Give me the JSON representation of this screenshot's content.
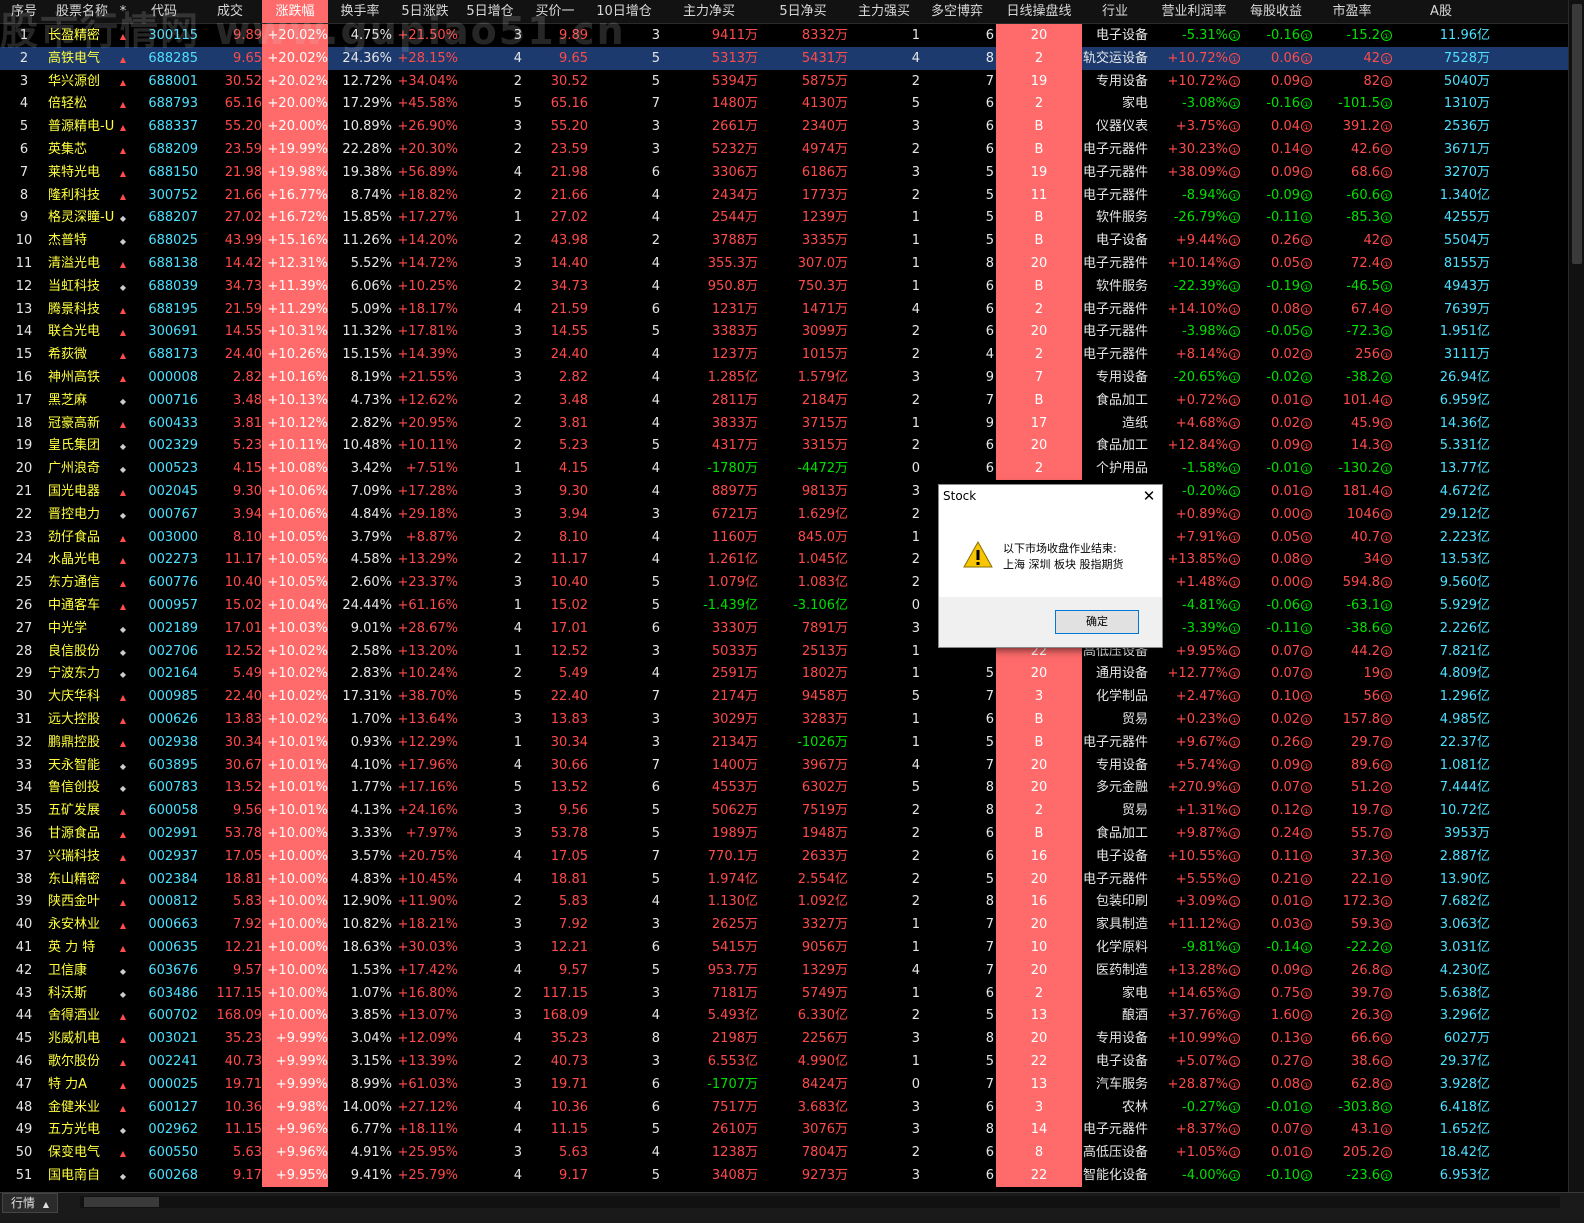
{
  "watermark": "股市行情网 www.gupiao51.cn",
  "header": [
    "序号",
    "股票名称",
    "*",
    "代码",
    "成交",
    "涨跌幅",
    "换手率",
    "5日涨跌",
    "5日增仓",
    "买价一",
    "10日增仓",
    "主力净买",
    "5日净买",
    "主力强买",
    "多空博弈",
    "日线操盘线",
    "行业",
    "营业利润率",
    "每股收益",
    "市盈率",
    "A股"
  ],
  "rows": [
    [
      "1",
      "长盈精密",
      "▲",
      "300115",
      "9.89",
      "+20.02%",
      "4.75%",
      "+21.50%",
      "3",
      "9.89",
      "3",
      "9411万",
      "8332万",
      "1",
      "6",
      "20",
      "电子设备",
      "-5.31%",
      "-0.16",
      "-15.2",
      "11.96亿"
    ],
    [
      "2",
      "高铁电气",
      "▲",
      "688285",
      "9.65",
      "+20.02%",
      "24.36%",
      "+28.15%",
      "4",
      "9.65",
      "5",
      "5313万",
      "5431万",
      "4",
      "8",
      "2",
      "轨交运设备",
      "+10.72%",
      "0.06",
      "42",
      "7528万"
    ],
    [
      "3",
      "华兴源创",
      "▲",
      "688001",
      "30.52",
      "+20.02%",
      "12.72%",
      "+34.04%",
      "2",
      "30.52",
      "5",
      "5394万",
      "5875万",
      "2",
      "7",
      "19",
      "专用设备",
      "+10.72%",
      "0.09",
      "82",
      "5040万"
    ],
    [
      "4",
      "倍轻松",
      "▲",
      "688793",
      "65.16",
      "+20.00%",
      "17.29%",
      "+45.58%",
      "5",
      "65.16",
      "7",
      "1480万",
      "4130万",
      "5",
      "6",
      "2",
      "家电",
      "-3.08%",
      "-0.16",
      "-101.5",
      "1310万"
    ],
    [
      "5",
      "普源精电-U",
      "▲",
      "688337",
      "55.20",
      "+20.00%",
      "10.89%",
      "+26.90%",
      "3",
      "55.20",
      "3",
      "2661万",
      "2340万",
      "3",
      "6",
      "B",
      "仪器仪表",
      "+3.75%",
      "0.04",
      "391.2",
      "2536万"
    ],
    [
      "6",
      "英集芯",
      "▲",
      "688209",
      "23.59",
      "+19.99%",
      "22.28%",
      "+20.30%",
      "2",
      "23.59",
      "3",
      "5232万",
      "4974万",
      "2",
      "6",
      "B",
      "电子元器件",
      "+30.23%",
      "0.14",
      "42.6",
      "3671万"
    ],
    [
      "7",
      "莱特光电",
      "▲",
      "688150",
      "21.98",
      "+19.98%",
      "19.38%",
      "+56.89%",
      "4",
      "21.98",
      "6",
      "3306万",
      "6186万",
      "3",
      "5",
      "19",
      "电子元器件",
      "+38.09%",
      "0.09",
      "68.6",
      "3270万"
    ],
    [
      "8",
      "隆利科技",
      "▲",
      "300752",
      "21.66",
      "+16.77%",
      "8.74%",
      "+18.82%",
      "2",
      "21.66",
      "4",
      "2434万",
      "1773万",
      "2",
      "5",
      "11",
      "电子元器件",
      "-8.94%",
      "-0.09",
      "-60.6",
      "1.340亿"
    ],
    [
      "9",
      "格灵深瞳-U",
      "◆",
      "688207",
      "27.02",
      "+16.72%",
      "15.85%",
      "+17.27%",
      "1",
      "27.02",
      "4",
      "2544万",
      "1239万",
      "1",
      "5",
      "B",
      "软件服务",
      "-26.79%",
      "-0.11",
      "-85.3",
      "4255万"
    ],
    [
      "10",
      "杰普特",
      "◆",
      "688025",
      "43.99",
      "+15.16%",
      "11.26%",
      "+14.20%",
      "2",
      "43.98",
      "2",
      "3788万",
      "3335万",
      "1",
      "5",
      "B",
      "电子设备",
      "+9.44%",
      "0.26",
      "42",
      "5504万"
    ],
    [
      "11",
      "清溢光电",
      "▲",
      "688138",
      "14.42",
      "+12.31%",
      "5.52%",
      "+14.72%",
      "3",
      "14.40",
      "4",
      "355.3万",
      "307.0万",
      "1",
      "8",
      "20",
      "电子元器件",
      "+10.14%",
      "0.05",
      "72.4",
      "8155万"
    ],
    [
      "12",
      "当虹科技",
      "◆",
      "688039",
      "34.73",
      "+11.39%",
      "6.06%",
      "+10.25%",
      "2",
      "34.73",
      "4",
      "950.8万",
      "750.3万",
      "1",
      "6",
      "B",
      "软件服务",
      "-22.39%",
      "-0.19",
      "-46.5",
      "4943万"
    ],
    [
      "13",
      "腾景科技",
      "▲",
      "688195",
      "21.59",
      "+11.29%",
      "5.09%",
      "+18.17%",
      "4",
      "21.59",
      "6",
      "1231万",
      "1471万",
      "4",
      "6",
      "2",
      "电子元器件",
      "+14.10%",
      "0.08",
      "67.4",
      "7639万"
    ],
    [
      "14",
      "联合光电",
      "▲",
      "300691",
      "14.55",
      "+10.31%",
      "11.32%",
      "+17.81%",
      "3",
      "14.55",
      "5",
      "3383万",
      "3099万",
      "2",
      "6",
      "20",
      "电子元器件",
      "-3.98%",
      "-0.05",
      "-72.3",
      "1.951亿"
    ],
    [
      "15",
      "希荻微",
      "▲",
      "688173",
      "24.40",
      "+10.26%",
      "15.15%",
      "+14.39%",
      "3",
      "24.40",
      "4",
      "1237万",
      "1015万",
      "2",
      "4",
      "2",
      "电子元器件",
      "+8.14%",
      "0.02",
      "256",
      "3111万"
    ],
    [
      "16",
      "神州高铁",
      "▲",
      "000008",
      "2.82",
      "+10.16%",
      "8.19%",
      "+21.55%",
      "3",
      "2.82",
      "4",
      "1.285亿",
      "1.579亿",
      "3",
      "9",
      "7",
      "专用设备",
      "-20.65%",
      "-0.02",
      "-38.2",
      "26.94亿"
    ],
    [
      "17",
      "黑芝麻",
      "◆",
      "000716",
      "3.48",
      "+10.13%",
      "4.73%",
      "+12.62%",
      "2",
      "3.48",
      "4",
      "2811万",
      "2184万",
      "2",
      "7",
      "B",
      "食品加工",
      "+0.72%",
      "0.01",
      "101.4",
      "6.959亿"
    ],
    [
      "18",
      "冠豪高新",
      "▲",
      "600433",
      "3.81",
      "+10.12%",
      "2.82%",
      "+20.95%",
      "2",
      "3.81",
      "4",
      "3833万",
      "3715万",
      "1",
      "9",
      "17",
      "造纸",
      "+4.68%",
      "0.02",
      "45.9",
      "14.36亿"
    ],
    [
      "19",
      "皇氏集团",
      "◆",
      "002329",
      "5.23",
      "+10.11%",
      "10.48%",
      "+10.11%",
      "2",
      "5.23",
      "5",
      "4317万",
      "3315万",
      "2",
      "6",
      "20",
      "食品加工",
      "+12.84%",
      "0.09",
      "14.3",
      "5.331亿"
    ],
    [
      "20",
      "广州浪奇",
      "◆",
      "000523",
      "4.15",
      "+10.08%",
      "3.42%",
      "+7.51%",
      "1",
      "4.15",
      "4",
      "-1780万",
      "-4472万",
      "0",
      "6",
      "2",
      "个护用品",
      "-1.58%",
      "-0.01",
      "-130.2",
      "13.77亿"
    ],
    [
      "21",
      "国光电器",
      "▲",
      "002045",
      "9.30",
      "+10.06%",
      "7.09%",
      "+17.28%",
      "3",
      "9.30",
      "4",
      "8897万",
      "9813万",
      "3",
      "",
      "",
      "",
      "-0.20%",
      "0.01",
      "181.4",
      "4.672亿"
    ],
    [
      "22",
      "晋控电力",
      "◆",
      "000767",
      "3.94",
      "+10.06%",
      "4.84%",
      "+29.18%",
      "3",
      "3.94",
      "3",
      "6721万",
      "1.629亿",
      "2",
      "",
      "",
      "",
      "+0.89%",
      "0.00",
      "1046",
      "29.12亿"
    ],
    [
      "23",
      "劲仔食品",
      "▲",
      "003000",
      "8.10",
      "+10.05%",
      "3.79%",
      "+8.87%",
      "2",
      "8.10",
      "4",
      "1160万",
      "845.0万",
      "1",
      "",
      "",
      "",
      "+7.91%",
      "0.05",
      "40.7",
      "2.223亿"
    ],
    [
      "24",
      "水晶光电",
      "▲",
      "002273",
      "11.17",
      "+10.05%",
      "4.58%",
      "+13.29%",
      "2",
      "11.17",
      "4",
      "1.261亿",
      "1.045亿",
      "2",
      "",
      "",
      "",
      "+13.85%",
      "0.08",
      "34",
      "13.53亿"
    ],
    [
      "25",
      "东方通信",
      "▲",
      "600776",
      "10.40",
      "+10.05%",
      "2.60%",
      "+23.37%",
      "3",
      "10.40",
      "5",
      "1.079亿",
      "1.083亿",
      "2",
      "",
      "",
      "",
      "+1.48%",
      "0.00",
      "594.8",
      "9.560亿"
    ],
    [
      "26",
      "中通客车",
      "▲",
      "000957",
      "15.02",
      "+10.04%",
      "24.44%",
      "+61.16%",
      "1",
      "15.02",
      "5",
      "-1.439亿",
      "-3.106亿",
      "0",
      "",
      "",
      "",
      "-4.81%",
      "-0.06",
      "-63.1",
      "5.929亿"
    ],
    [
      "27",
      "中光学",
      "◆",
      "002189",
      "17.01",
      "+10.03%",
      "9.01%",
      "+28.67%",
      "4",
      "17.01",
      "6",
      "3330万",
      "7891万",
      "3",
      "",
      "",
      "",
      "-3.39%",
      "-0.11",
      "-38.6",
      "2.226亿"
    ],
    [
      "28",
      "良信股份",
      "◆",
      "002706",
      "12.52",
      "+10.02%",
      "2.58%",
      "+13.20%",
      "1",
      "12.52",
      "3",
      "5033万",
      "2513万",
      "1",
      "",
      "22",
      "高低压设备",
      "+9.95%",
      "0.07",
      "44.2",
      "7.821亿"
    ],
    [
      "29",
      "宁波东力",
      "◆",
      "002164",
      "5.49",
      "+10.02%",
      "2.83%",
      "+10.24%",
      "2",
      "5.49",
      "4",
      "2591万",
      "1802万",
      "1",
      "5",
      "20",
      "通用设备",
      "+12.77%",
      "0.07",
      "19",
      "4.809亿"
    ],
    [
      "30",
      "大庆华科",
      "▲",
      "000985",
      "22.40",
      "+10.02%",
      "17.31%",
      "+38.70%",
      "5",
      "22.40",
      "7",
      "2174万",
      "9458万",
      "5",
      "7",
      "3",
      "化学制品",
      "+2.47%",
      "0.10",
      "56",
      "1.296亿"
    ],
    [
      "31",
      "远大控股",
      "▲",
      "000626",
      "13.83",
      "+10.02%",
      "1.70%",
      "+13.64%",
      "3",
      "13.83",
      "3",
      "3029万",
      "3283万",
      "1",
      "6",
      "B",
      "贸易",
      "+0.23%",
      "0.02",
      "157.8",
      "4.985亿"
    ],
    [
      "32",
      "鹏鼎控股",
      "▲",
      "002938",
      "30.34",
      "+10.01%",
      "0.93%",
      "+12.29%",
      "1",
      "30.34",
      "3",
      "2134万",
      "-1026万",
      "1",
      "5",
      "B",
      "电子元器件",
      "+9.67%",
      "0.26",
      "29.7",
      "22.37亿"
    ],
    [
      "33",
      "天永智能",
      "◆",
      "603895",
      "30.67",
      "+10.01%",
      "4.10%",
      "+17.96%",
      "4",
      "30.66",
      "7",
      "1400万",
      "3967万",
      "4",
      "7",
      "20",
      "专用设备",
      "+5.74%",
      "0.09",
      "89.6",
      "1.081亿"
    ],
    [
      "34",
      "鲁信创投",
      "◆",
      "600783",
      "13.52",
      "+10.01%",
      "1.77%",
      "+17.16%",
      "5",
      "13.52",
      "6",
      "4553万",
      "6302万",
      "5",
      "8",
      "20",
      "多元金融",
      "+270.9%",
      "0.07",
      "51.2",
      "7.444亿"
    ],
    [
      "35",
      "五矿发展",
      "▲",
      "600058",
      "9.56",
      "+10.01%",
      "4.13%",
      "+24.16%",
      "3",
      "9.56",
      "5",
      "5062万",
      "7519万",
      "2",
      "8",
      "2",
      "贸易",
      "+1.31%",
      "0.12",
      "19.7",
      "10.72亿"
    ],
    [
      "36",
      "甘源食品",
      "▲",
      "002991",
      "53.78",
      "+10.00%",
      "3.33%",
      "+7.97%",
      "3",
      "53.78",
      "5",
      "1989万",
      "1948万",
      "2",
      "6",
      "B",
      "食品加工",
      "+9.87%",
      "0.24",
      "55.7",
      "3953万"
    ],
    [
      "37",
      "兴瑞科技",
      "▲",
      "002937",
      "17.05",
      "+10.00%",
      "3.57%",
      "+20.75%",
      "4",
      "17.05",
      "7",
      "770.1万",
      "2633万",
      "2",
      "6",
      "16",
      "电子设备",
      "+10.55%",
      "0.11",
      "37.3",
      "2.887亿"
    ],
    [
      "38",
      "东山精密",
      "▲",
      "002384",
      "18.81",
      "+10.00%",
      "4.83%",
      "+10.45%",
      "4",
      "18.81",
      "5",
      "1.974亿",
      "2.554亿",
      "2",
      "5",
      "20",
      "电子元器件",
      "+5.55%",
      "0.21",
      "22.1",
      "13.90亿"
    ],
    [
      "39",
      "陕西金叶",
      "▲",
      "000812",
      "5.83",
      "+10.00%",
      "12.90%",
      "+11.90%",
      "2",
      "5.83",
      "4",
      "1.130亿",
      "1.092亿",
      "2",
      "8",
      "16",
      "包装印刷",
      "+3.09%",
      "0.01",
      "172.3",
      "7.682亿"
    ],
    [
      "40",
      "永安林业",
      "▲",
      "000663",
      "7.92",
      "+10.00%",
      "10.82%",
      "+18.21%",
      "3",
      "7.92",
      "3",
      "2625万",
      "3327万",
      "1",
      "7",
      "20",
      "家具制造",
      "+11.12%",
      "0.03",
      "59.3",
      "3.063亿"
    ],
    [
      "41",
      "英 力 特",
      "▲",
      "000635",
      "12.21",
      "+10.00%",
      "18.63%",
      "+30.03%",
      "3",
      "12.21",
      "6",
      "5415万",
      "9056万",
      "1",
      "7",
      "10",
      "化学原料",
      "-9.81%",
      "-0.14",
      "-22.2",
      "3.031亿"
    ],
    [
      "42",
      "卫信康",
      "◆",
      "603676",
      "9.57",
      "+10.00%",
      "1.53%",
      "+17.42%",
      "4",
      "9.57",
      "5",
      "953.7万",
      "1329万",
      "4",
      "7",
      "20",
      "医药制造",
      "+13.28%",
      "0.09",
      "26.8",
      "4.230亿"
    ],
    [
      "43",
      "科沃斯",
      "◆",
      "603486",
      "117.15",
      "+10.00%",
      "1.07%",
      "+16.80%",
      "2",
      "117.15",
      "3",
      "7181万",
      "5749万",
      "1",
      "6",
      "2",
      "家电",
      "+14.65%",
      "0.75",
      "39.7",
      "5.638亿"
    ],
    [
      "44",
      "舍得酒业",
      "▲",
      "600702",
      "168.09",
      "+10.00%",
      "3.85%",
      "+13.07%",
      "3",
      "168.09",
      "4",
      "5.493亿",
      "6.330亿",
      "2",
      "5",
      "13",
      "酿酒",
      "+37.76%",
      "1.60",
      "26.3",
      "3.296亿"
    ],
    [
      "45",
      "兆威机电",
      "▲",
      "003021",
      "35.23",
      "+9.99%",
      "3.04%",
      "+12.09%",
      "4",
      "35.23",
      "8",
      "2198万",
      "2256万",
      "3",
      "8",
      "20",
      "专用设备",
      "+10.99%",
      "0.13",
      "66.6",
      "6027万"
    ],
    [
      "46",
      "歌尔股份",
      "▲",
      "002241",
      "40.73",
      "+9.99%",
      "3.15%",
      "+13.39%",
      "2",
      "40.73",
      "3",
      "6.553亿",
      "4.990亿",
      "1",
      "5",
      "22",
      "电子设备",
      "+5.07%",
      "0.27",
      "38.6",
      "29.37亿"
    ],
    [
      "47",
      "特 力A",
      "▲",
      "000025",
      "19.71",
      "+9.99%",
      "8.99%",
      "+61.03%",
      "3",
      "19.71",
      "6",
      "-1707万",
      "8424万",
      "0",
      "7",
      "13",
      "汽车服务",
      "+28.87%",
      "0.08",
      "62.8",
      "3.928亿"
    ],
    [
      "48",
      "金健米业",
      "▲",
      "600127",
      "10.36",
      "+9.98%",
      "14.00%",
      "+27.12%",
      "4",
      "10.36",
      "6",
      "7517万",
      "3.683亿",
      "3",
      "6",
      "3",
      "农林",
      "-0.27%",
      "-0.01",
      "-303.8",
      "6.418亿"
    ],
    [
      "49",
      "五方光电",
      "◆",
      "002962",
      "11.15",
      "+9.96%",
      "6.77%",
      "+18.11%",
      "4",
      "11.15",
      "5",
      "2610万",
      "3076万",
      "3",
      "8",
      "14",
      "电子元器件",
      "+8.37%",
      "0.07",
      "43.1",
      "1.652亿"
    ],
    [
      "50",
      "保变电气",
      "▲",
      "600550",
      "5.63",
      "+9.96%",
      "4.91%",
      "+25.95%",
      "3",
      "5.63",
      "4",
      "1238万",
      "7804万",
      "2",
      "6",
      "8",
      "高低压设备",
      "+1.05%",
      "0.01",
      "205.2",
      "18.42亿"
    ],
    [
      "51",
      "国电南自",
      "◆",
      "600268",
      "9.17",
      "+9.95%",
      "9.41%",
      "+25.79%",
      "4",
      "9.17",
      "5",
      "3408万",
      "9273万",
      "3",
      "6",
      "22",
      "智能化设备",
      "-4.00%",
      "-0.10",
      "-23.6",
      "6.953亿"
    ]
  ],
  "circle_glyph": "①",
  "dialog": {
    "title": "Stock",
    "close": "✕",
    "line1": "以下市场收盘作业结束:",
    "line2": "上海 深圳 板块 股指期货",
    "ok": "确定",
    "icon": "warning-icon"
  },
  "bottom_tab": "行情",
  "bottom_tab_arrow": "▲",
  "colors": {
    "background": "#000000",
    "highlight_cell": "#ff6b6b",
    "selected_row": "#1c3a6e",
    "up": "#ff4b4b",
    "down": "#00e000",
    "name": "#ffff3f",
    "market_cap": "#4ee0ff"
  }
}
